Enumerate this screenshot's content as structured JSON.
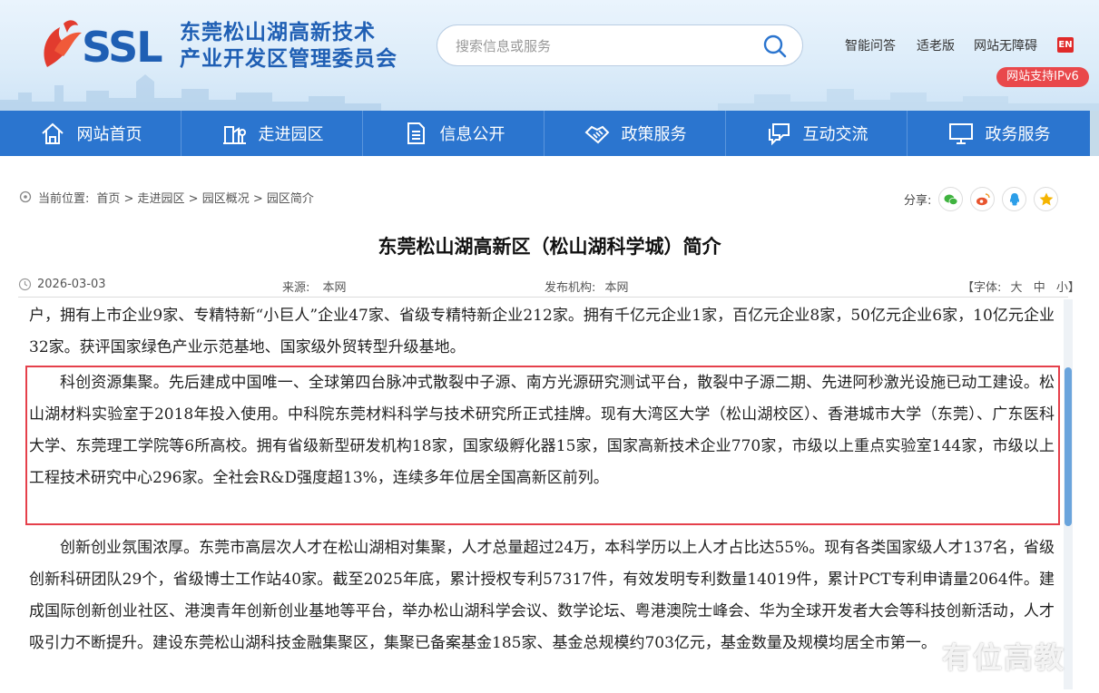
{
  "header": {
    "org_name_line1": "东莞松山湖高新技术",
    "org_name_line2": "产业开发区管理委员会",
    "search_placeholder": "搜索信息或服务",
    "links": [
      "智能问答",
      "适老版",
      "网站无障碍"
    ],
    "en_label": "EN",
    "ipv6_label": "网站支持IPv6"
  },
  "nav": {
    "items": [
      {
        "label": "网站首页",
        "icon": "home-icon"
      },
      {
        "label": "走进园区",
        "icon": "park-icon"
      },
      {
        "label": "信息公开",
        "icon": "document-icon"
      },
      {
        "label": "政策服务",
        "icon": "handshake-icon"
      },
      {
        "label": "互动交流",
        "icon": "chat-icon"
      },
      {
        "label": "政务服务",
        "icon": "monitor-icon"
      }
    ]
  },
  "breadcrumb": {
    "prefix": "当前位置:",
    "path": "首页 > 走进园区 > 园区概况 > 园区简介"
  },
  "share": {
    "label": "分享:",
    "targets": [
      "wechat-icon",
      "weibo-icon",
      "qq-icon",
      "qzone-icon"
    ]
  },
  "article": {
    "title": "东莞松山湖高新区（松山湖科学城）简介",
    "date": "2026-03-03",
    "source_label": "来源:",
    "source": "本网",
    "publisher_label": "发布机构:",
    "publisher": "本网",
    "font_label": "【字体:",
    "font_large": "大",
    "font_medium": "中",
    "font_small": "小】",
    "paragraphs": [
      "户，拥有上市企业9家、专精特新“小巨人”企业47家、省级专精特新企业212家。拥有千亿元企业1家，百亿元企业8家，50亿元企业6家，10亿元企业32家。获评国家绿色产业示范基地、国家级外贸转型升级基地。",
      "科创资源集聚。先后建成中国唯一、全球第四台脉冲式散裂中子源、南方光源研究测试平台，散裂中子源二期、先进阿秒激光设施已动工建设。松山湖材料实验室于2018年投入使用。中科院东莞材料科学与技术研究所正式挂牌。现有大湾区大学（松山湖校区）、香港城市大学（东莞）、广东医科大学、东莞理工学院等6所高校。拥有省级新型研发机构18家，国家级孵化器15家，国家高新技术企业770家，市级以上重点实验室144家，市级以上工程技术研究中心296家。全社会R&D强度超13%，连续多年位居全国高新区前列。",
      "创新创业氛围浓厚。东莞市高层次人才在松山湖相对集聚，人才总量超过24万，本科学历以上人才占比达55%。现有各类国家级人才137名，省级创新科研团队29个，省级博士工作站40家。截至2025年底，累计授权专利57317件，有效发明专利数量14019件，累计PCT专利申请量2064件。建成国际创新创业社区、港澳青年创新创业基地等平台，举办松山湖科学会议、数学论坛、粤港澳院士峰会、华为全球开发者大会等科技创新活动，人才吸引力不断提升。建设东莞松山湖科技金融集聚区，集聚已备案基金185家、基金总规模约703亿元，基金数量及规模均居全市第一。"
    ]
  },
  "watermark": "有位高教",
  "colors": {
    "brand_blue": "#2b75cf",
    "highlight_red": "#e5404b",
    "ipv6_red": "#e9484b"
  }
}
